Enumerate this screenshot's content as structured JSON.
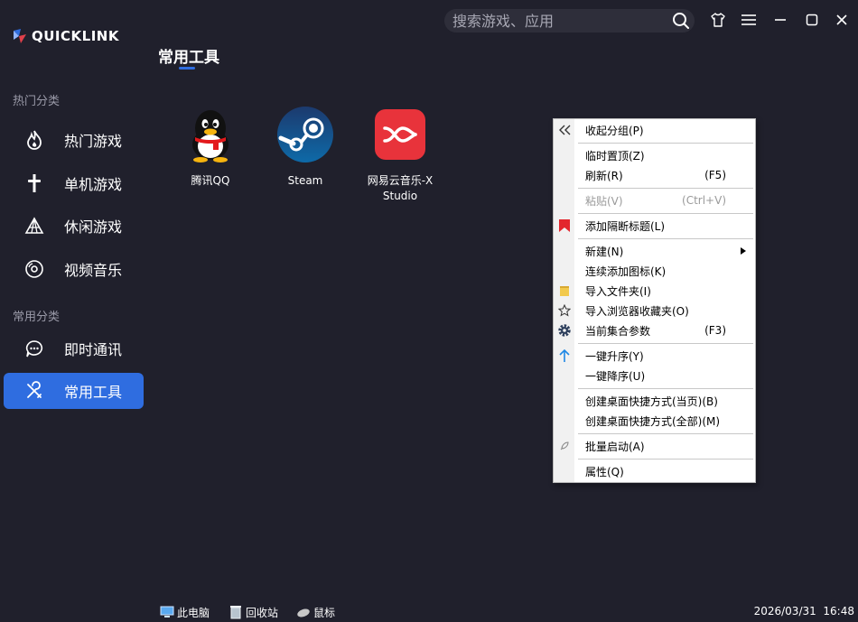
{
  "app": {
    "logo_text": "QUICKLINK"
  },
  "sidebar": {
    "sections": [
      {
        "title": "热门分类"
      },
      {
        "title": "常用分类"
      }
    ],
    "items": [
      {
        "label": "热门游戏",
        "icon": "flame-icon"
      },
      {
        "label": "单机游戏",
        "icon": "sword-icon"
      },
      {
        "label": "休闲游戏",
        "icon": "tent-icon"
      },
      {
        "label": "视频音乐",
        "icon": "disc-icon"
      },
      {
        "label": "即时通讯",
        "icon": "chat-bubble-icon"
      },
      {
        "label": "常用工具",
        "icon": "tools-icon",
        "active": true
      }
    ]
  },
  "header": {
    "search_placeholder": "搜索游戏、应用",
    "page_title": "常用工具"
  },
  "apps": [
    {
      "label": "腾讯QQ",
      "icon": "qq-penguin-icon"
    },
    {
      "label": "Steam",
      "icon": "steam-icon"
    },
    {
      "label": "网易云音乐-X Studio",
      "icon": "x-studio-icon"
    }
  ],
  "context_menu": {
    "items": [
      {
        "label": "收起分组(P)",
        "shortcut": ""
      },
      {
        "label": "临时置顶(Z)",
        "shortcut": ""
      },
      {
        "label": "刷新(R)",
        "shortcut": "(F5)"
      },
      {
        "label": "粘贴(V)",
        "shortcut": "(Ctrl+V)",
        "disabled": true
      },
      {
        "label": "添加隔断标题(L)",
        "shortcut": ""
      },
      {
        "label": "新建(N)",
        "shortcut": ""
      },
      {
        "label": "连续添加图标(K)",
        "shortcut": ""
      },
      {
        "label": "导入文件夹(I)",
        "shortcut": ""
      },
      {
        "label": "导入浏览器收藏夹(O)",
        "shortcut": ""
      },
      {
        "label": "当前集合参数",
        "shortcut": "(F3)"
      },
      {
        "label": "一键升序(Y)",
        "shortcut": ""
      },
      {
        "label": "一键降序(U)",
        "shortcut": ""
      },
      {
        "label": "创建桌面快捷方式(当页)(B)",
        "shortcut": ""
      },
      {
        "label": "创建桌面快捷方式(全部)(M)",
        "shortcut": ""
      },
      {
        "label": "批量启动(A)",
        "shortcut": ""
      },
      {
        "label": "属性(Q)",
        "shortcut": ""
      }
    ]
  },
  "taskbar": {
    "items": [
      {
        "label": "此电脑",
        "icon": "computer-icon"
      },
      {
        "label": "回收站",
        "icon": "recycle-bin-icon"
      },
      {
        "label": "鼠标",
        "icon": "mouse-icon"
      }
    ],
    "date": "2026/03/31",
    "time": "16:48"
  },
  "colors": {
    "background": "#20202c",
    "accent": "#2f6de0"
  }
}
